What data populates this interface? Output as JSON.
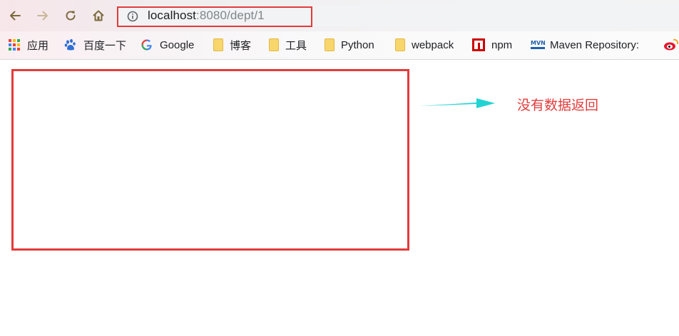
{
  "browser": {
    "address_bar": {
      "host": "localhost",
      "path": ":8080/dept/1"
    },
    "nav": {
      "back": "arrow-left-icon",
      "forward": "arrow-right-icon",
      "reload": "reload-icon",
      "home": "home-icon"
    },
    "bookmarks": [
      {
        "label": "应用",
        "icon": "apps-grid-icon"
      },
      {
        "label": "百度一下",
        "icon": "baidu-paw-icon"
      },
      {
        "label": "Google",
        "icon": "google-g-icon"
      },
      {
        "label": "博客",
        "icon": "folder-icon"
      },
      {
        "label": "工具",
        "icon": "folder-icon"
      },
      {
        "label": "Python",
        "icon": "folder-icon"
      },
      {
        "label": "webpack",
        "icon": "folder-icon"
      },
      {
        "label": "npm",
        "icon": "npm-icon"
      },
      {
        "label": "Maven Repository: ",
        "icon": "mvn-icon"
      }
    ],
    "accent_red": "#e43a3a"
  },
  "page": {
    "annotation": "没有数据返回",
    "arrow_color": "#22d3d3"
  }
}
